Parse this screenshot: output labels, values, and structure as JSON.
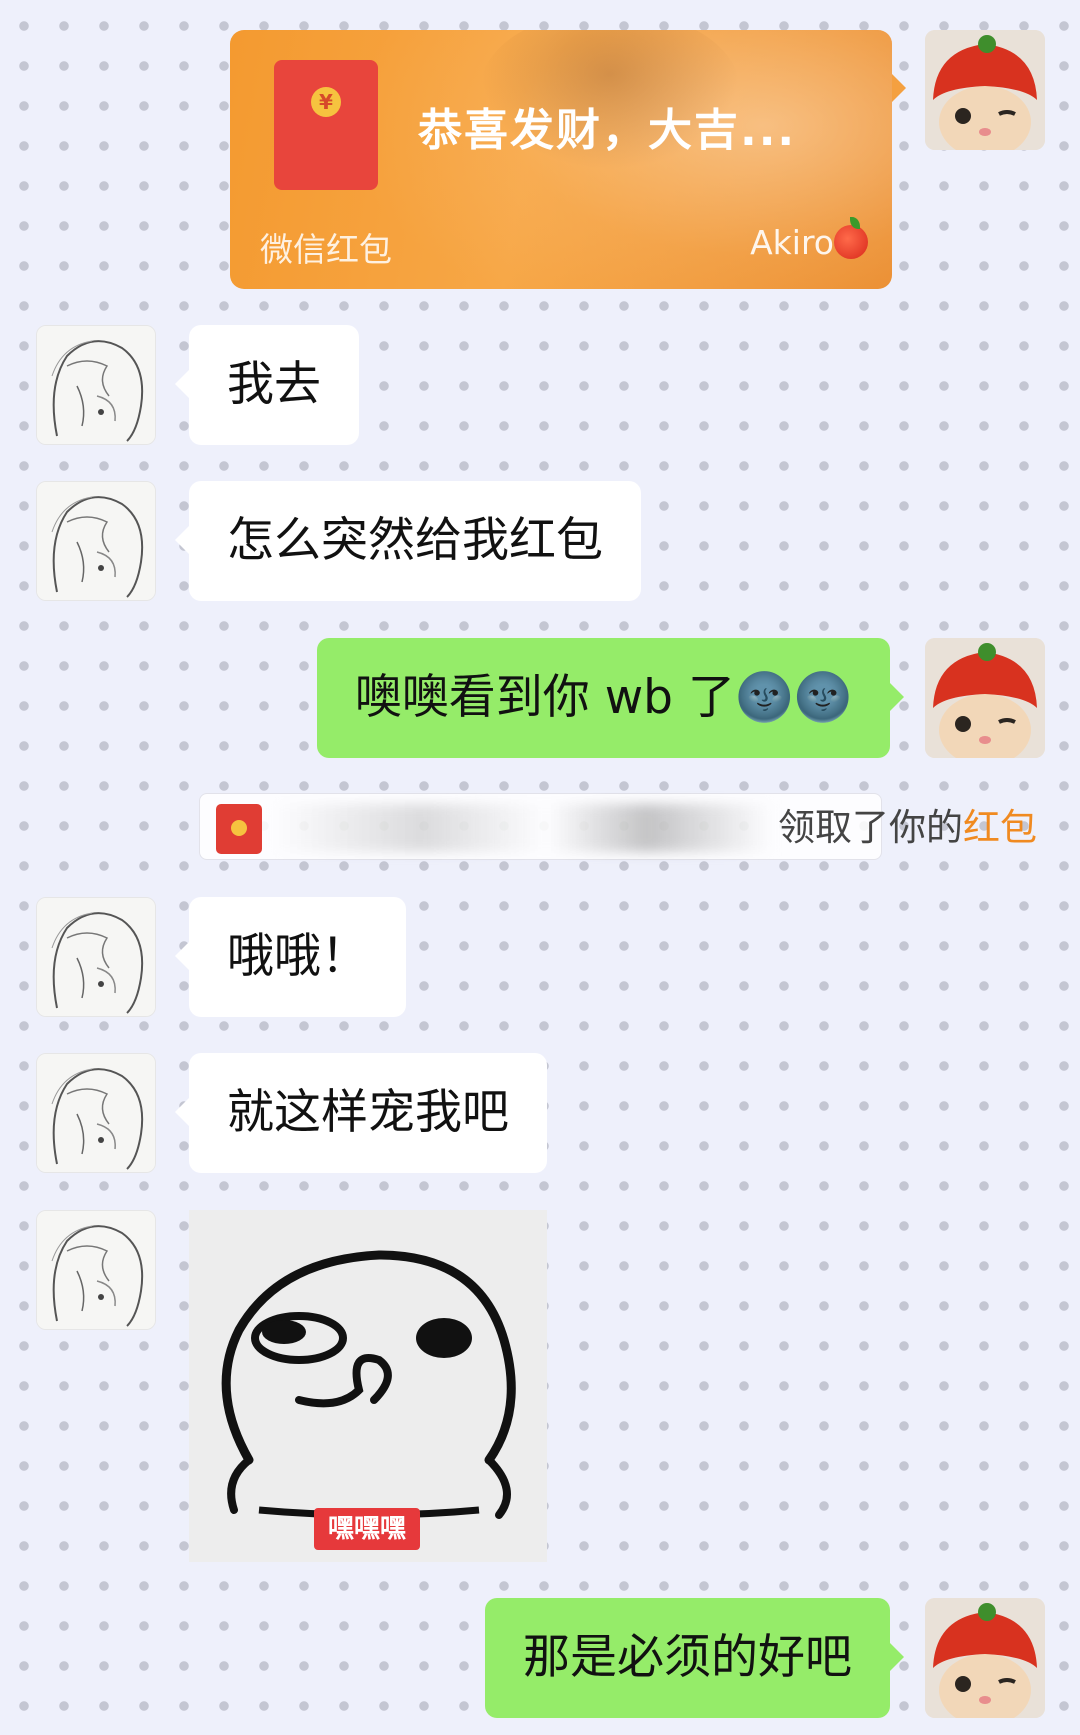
{
  "messages": {
    "red_packet": {
      "title": "恭喜发财，大吉...",
      "coin_symbol": "¥",
      "footer_left": "微信红包",
      "footer_right": "Akiro"
    },
    "m1": "我去",
    "m2": "怎么突然给我红包",
    "m3": "噢噢看到你 wb 了🌚🌚",
    "notice": {
      "text": "领取了你的",
      "highlight": "红包"
    },
    "m4": "哦哦！",
    "m5": "就这样宠我吧",
    "sticker_label": "嘿嘿嘿",
    "m6": "那是必须的好吧"
  },
  "colors": {
    "background": "#eef0fb",
    "bubble_green": "#95ec69",
    "bubble_white": "#ffffff",
    "red_packet": "#f49a30",
    "highlight": "#f08a20"
  },
  "icons": {
    "self_avatar": "cat-in-apple-hat-avatar",
    "other_avatar": "sketch-girl-avatar",
    "packet": "red-envelope-icon",
    "apple": "apple-icon"
  }
}
